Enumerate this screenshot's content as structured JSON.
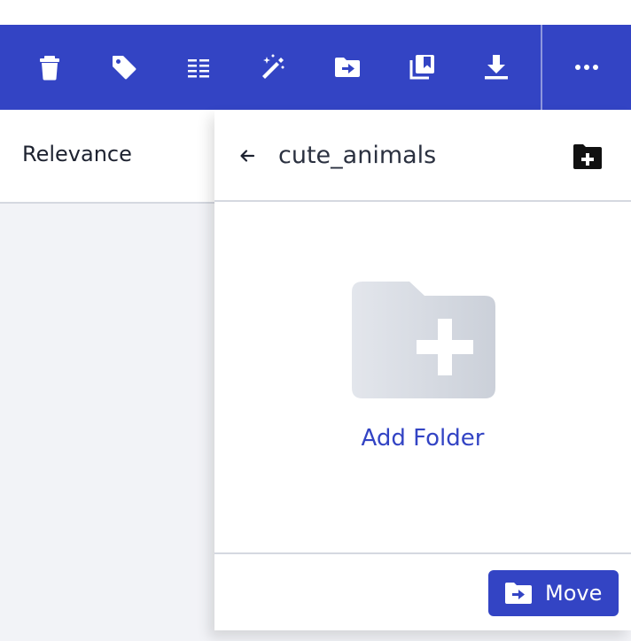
{
  "colors": {
    "toolbar": "#3344c4",
    "accent": "#3344c4",
    "panel_bg": "#ffffff",
    "page_bg": "#f2f3f7"
  },
  "toolbar": {
    "buttons": [
      {
        "icon": "trash-icon"
      },
      {
        "icon": "tag-icon"
      },
      {
        "icon": "list-icon"
      },
      {
        "icon": "magic-wand-icon"
      },
      {
        "icon": "move-folder-icon"
      },
      {
        "icon": "collections-icon"
      },
      {
        "icon": "download-icon"
      },
      {
        "icon": "more-icon"
      }
    ]
  },
  "sort": {
    "label": "Relevance"
  },
  "panel": {
    "title": "cute_animals",
    "back_icon": "arrow-left-icon",
    "new_folder_icon": "folder-plus-icon",
    "empty_state": {
      "icon": "folder-plus-icon",
      "label": "Add Folder"
    },
    "footer": {
      "move_label": "Move",
      "move_icon": "move-folder-icon"
    }
  }
}
